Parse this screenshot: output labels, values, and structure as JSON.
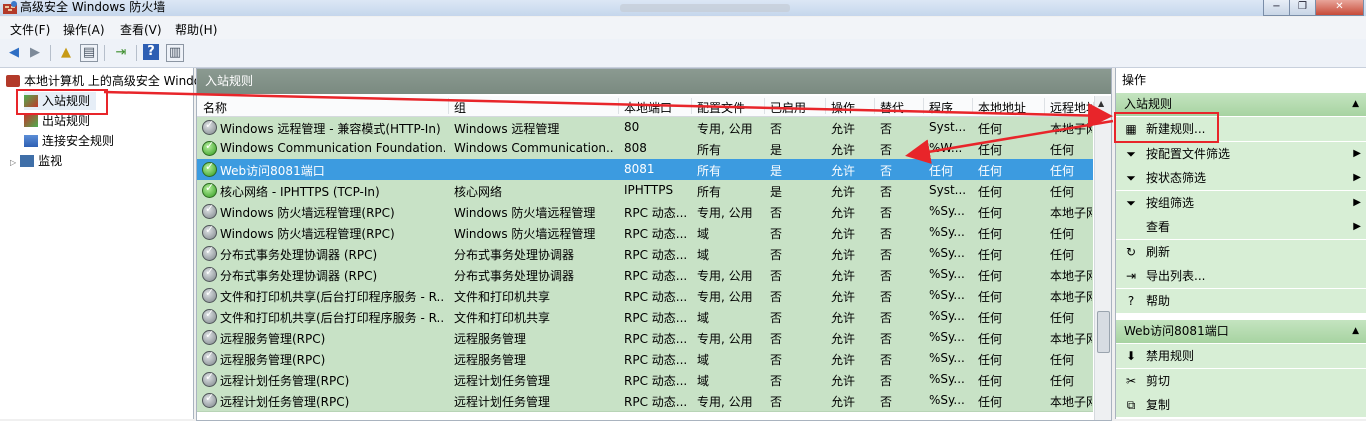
{
  "window": {
    "title": "高级安全 Windows 防火墙",
    "buttons": {
      "minimize": "−",
      "restore": "❐",
      "close": "✕"
    }
  },
  "menu": [
    "文件(F)",
    "操作(A)",
    "查看(V)",
    "帮助(H)"
  ],
  "tree": {
    "root": "本地计算机 上的高级安全 Windows 防火墙",
    "items": [
      "入站规则",
      "出站规则",
      "连接安全规则",
      "监视"
    ]
  },
  "center": {
    "header": "入站规则",
    "columns": [
      "名称",
      "组",
      "本地端口",
      "配置文件",
      "已启用",
      "操作",
      "替代",
      "程序",
      "本地地址",
      "远程地址"
    ],
    "rows": [
      {
        "name": "Windows 远程管理 - 兼容模式(HTTP-In)",
        "group": "Windows 远程管理",
        "port": "80",
        "profile": "专用, 公用",
        "enabled": "否",
        "action": "允许",
        "override": "否",
        "program": "Syst...",
        "local": "任何",
        "remote": "本地子网",
        "on": false
      },
      {
        "name": "Windows Communication Foundation...",
        "group": "Windows Communication...",
        "port": "808",
        "profile": "所有",
        "enabled": "是",
        "action": "允许",
        "override": "否",
        "program": "%W...",
        "local": "任何",
        "remote": "任何",
        "on": true
      },
      {
        "name": "Web访问8081端口",
        "group": "",
        "port": "8081",
        "profile": "所有",
        "enabled": "是",
        "action": "允许",
        "override": "否",
        "program": "任何",
        "local": "任何",
        "remote": "任何",
        "on": true,
        "selected": true
      },
      {
        "name": "核心网络 - IPHTTPS (TCP-In)",
        "group": "核心网络",
        "port": "IPHTTPS",
        "profile": "所有",
        "enabled": "是",
        "action": "允许",
        "override": "否",
        "program": "Syst...",
        "local": "任何",
        "remote": "任何",
        "on": true
      },
      {
        "name": "Windows 防火墙远程管理(RPC)",
        "group": "Windows 防火墙远程管理",
        "port": "RPC 动态...",
        "profile": "专用, 公用",
        "enabled": "否",
        "action": "允许",
        "override": "否",
        "program": "%Sy...",
        "local": "任何",
        "remote": "本地子网",
        "on": false
      },
      {
        "name": "Windows 防火墙远程管理(RPC)",
        "group": "Windows 防火墙远程管理",
        "port": "RPC 动态...",
        "profile": "域",
        "enabled": "否",
        "action": "允许",
        "override": "否",
        "program": "%Sy...",
        "local": "任何",
        "remote": "任何",
        "on": false
      },
      {
        "name": "分布式事务处理协调器 (RPC)",
        "group": "分布式事务处理协调器",
        "port": "RPC 动态...",
        "profile": "域",
        "enabled": "否",
        "action": "允许",
        "override": "否",
        "program": "%Sy...",
        "local": "任何",
        "remote": "任何",
        "on": false
      },
      {
        "name": "分布式事务处理协调器 (RPC)",
        "group": "分布式事务处理协调器",
        "port": "RPC 动态...",
        "profile": "专用, 公用",
        "enabled": "否",
        "action": "允许",
        "override": "否",
        "program": "%Sy...",
        "local": "任何",
        "remote": "本地子网",
        "on": false
      },
      {
        "name": "文件和打印机共享(后台打印程序服务 - R...",
        "group": "文件和打印机共享",
        "port": "RPC 动态...",
        "profile": "专用, 公用",
        "enabled": "否",
        "action": "允许",
        "override": "否",
        "program": "%Sy...",
        "local": "任何",
        "remote": "本地子网",
        "on": false
      },
      {
        "name": "文件和打印机共享(后台打印程序服务 - R...",
        "group": "文件和打印机共享",
        "port": "RPC 动态...",
        "profile": "域",
        "enabled": "否",
        "action": "允许",
        "override": "否",
        "program": "%Sy...",
        "local": "任何",
        "remote": "任何",
        "on": false
      },
      {
        "name": "远程服务管理(RPC)",
        "group": "远程服务管理",
        "port": "RPC 动态...",
        "profile": "专用, 公用",
        "enabled": "否",
        "action": "允许",
        "override": "否",
        "program": "%Sy...",
        "local": "任何",
        "remote": "本地子网",
        "on": false
      },
      {
        "name": "远程服务管理(RPC)",
        "group": "远程服务管理",
        "port": "RPC 动态...",
        "profile": "域",
        "enabled": "否",
        "action": "允许",
        "override": "否",
        "program": "%Sy...",
        "local": "任何",
        "remote": "任何",
        "on": false
      },
      {
        "name": "远程计划任务管理(RPC)",
        "group": "远程计划任务管理",
        "port": "RPC 动态...",
        "profile": "域",
        "enabled": "否",
        "action": "允许",
        "override": "否",
        "program": "%Sy...",
        "local": "任何",
        "remote": "任何",
        "on": false
      },
      {
        "name": "远程计划任务管理(RPC)",
        "group": "远程计划任务管理",
        "port": "RPC 动态...",
        "profile": "专用, 公用",
        "enabled": "否",
        "action": "允许",
        "override": "否",
        "program": "%Sy...",
        "local": "任何",
        "remote": "本地子网",
        "on": false
      }
    ]
  },
  "actions": {
    "title": "操作",
    "section1": "入站规则",
    "items1": [
      {
        "label": "新建规则...",
        "icon": "new-rule-icon",
        "glyph": "▦",
        "arrow": ""
      },
      {
        "label": "按配置文件筛选",
        "icon": "filter-icon",
        "glyph": "⏷",
        "arrow": "▶"
      },
      {
        "label": "按状态筛选",
        "icon": "filter-icon",
        "glyph": "⏷",
        "arrow": "▶"
      },
      {
        "label": "按组筛选",
        "icon": "filter-icon",
        "glyph": "⏷",
        "arrow": "▶"
      },
      {
        "label": "查看",
        "icon": "",
        "glyph": "",
        "arrow": "▶"
      },
      {
        "label": "刷新",
        "icon": "refresh-icon",
        "glyph": "↻",
        "arrow": ""
      },
      {
        "label": "导出列表...",
        "icon": "export-icon",
        "glyph": "⇥",
        "arrow": ""
      },
      {
        "label": "帮助",
        "icon": "help-icon",
        "glyph": "?",
        "arrow": ""
      }
    ],
    "section2": "Web访问8081端口",
    "items2": [
      {
        "label": "禁用规则",
        "icon": "disable-icon",
        "glyph": "⬇",
        "arrow": ""
      },
      {
        "label": "剪切",
        "icon": "cut-icon",
        "glyph": "✂",
        "arrow": ""
      },
      {
        "label": "复制",
        "icon": "copy-icon",
        "glyph": "⧉",
        "arrow": ""
      }
    ]
  },
  "colors": {
    "row_green": "#c8e2c6",
    "selected": "#3c9be0",
    "annotation": "#e8252a"
  }
}
